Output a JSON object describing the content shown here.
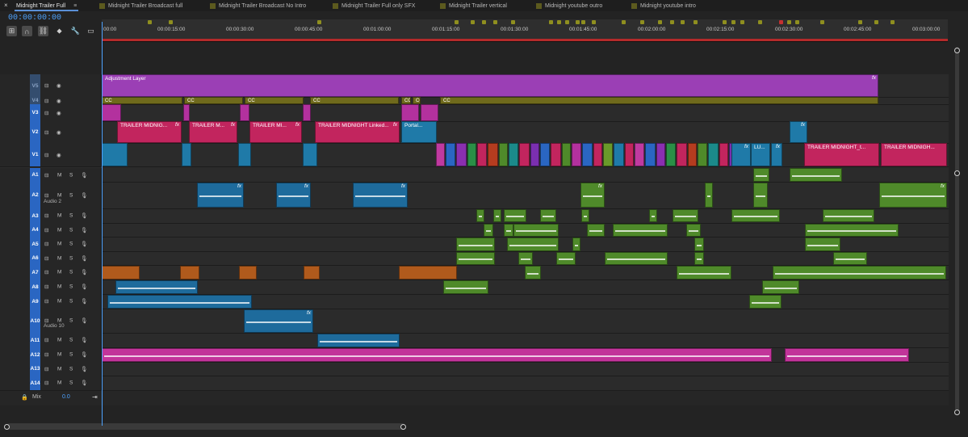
{
  "tabs": [
    {
      "label": "Midnight Trailer Full",
      "active": true
    },
    {
      "label": "Midnight Trailer Broadcast full"
    },
    {
      "label": "Midnight Trailer Broadcast No Intro"
    },
    {
      "label": "Midnight Trailer Full only SFX"
    },
    {
      "label": "Midnight Trailer vertical"
    },
    {
      "label": "Midnight youtube outro"
    },
    {
      "label": "Midnight youtube intro"
    }
  ],
  "timecode": "00:00:00:00",
  "ruler_ticks": [
    "00:00",
    "00:00:15:00",
    "00:00:30:00",
    "00:00:45:00",
    "00:01:00:00",
    "00:01:15:00",
    "00:01:30:00",
    "00:01:45:00",
    "00:02:00:00",
    "00:02:15:00",
    "00:02:30:00",
    "00:02:45:00",
    "00:03:00:00"
  ],
  "video_tracks": [
    {
      "id": "V5",
      "enabled": false
    },
    {
      "id": "V4",
      "enabled": false
    },
    {
      "id": "V3",
      "enabled": true
    },
    {
      "id": "V2",
      "enabled": true
    },
    {
      "id": "V1",
      "enabled": true
    }
  ],
  "audio_tracks": [
    {
      "id": "A1"
    },
    {
      "id": "A2",
      "name": "Audio 2"
    },
    {
      "id": "A3"
    },
    {
      "id": "A4"
    },
    {
      "id": "A5"
    },
    {
      "id": "A6"
    },
    {
      "id": "A7"
    },
    {
      "id": "A8"
    },
    {
      "id": "A9"
    },
    {
      "id": "A10",
      "name": "Audio 10"
    },
    {
      "id": "A11"
    },
    {
      "id": "A12"
    },
    {
      "id": "A13"
    },
    {
      "id": "A14"
    }
  ],
  "mix": {
    "label": "Mix",
    "value": "0.0"
  },
  "clip_labels": {
    "adjustment": "Adjustment Layer",
    "v2_1": "TRAILER MIDNIG...",
    "v2_2": "TRAILER M...",
    "v2_3": "TRAILER MI...",
    "v2_4": "TRAILER MIDNIGHT Linked...",
    "v2_5": "Portal...",
    "v1_1": "TRAILER MIDNIGHT_t...",
    "v1_2": "TRAILER MIDNIGH...",
    "v1_lu": "LU...",
    "cc": "CC",
    "fx": "fx",
    "track_toggle_m": "M",
    "track_toggle_s": "S"
  },
  "colors": {
    "accent": "#2a66c2",
    "adjustment": "#9b3fb5",
    "caption": "#6f6a1c",
    "video_pink": "#c2255e",
    "audio_blue": "#1e6b9c",
    "audio_green": "#4f8a2a",
    "audio_orange": "#b05a1c",
    "audio_pink": "#c2349a"
  }
}
